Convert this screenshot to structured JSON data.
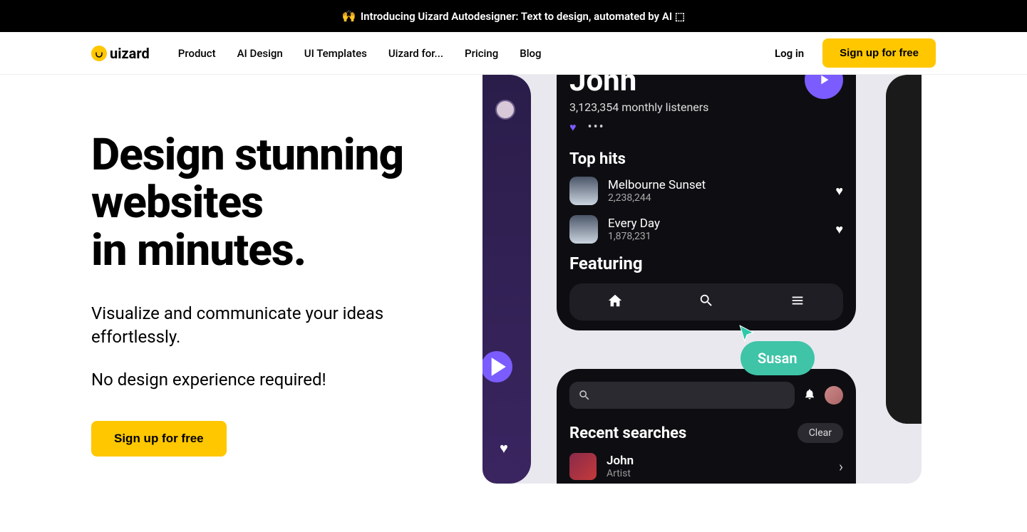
{
  "announcement": {
    "emoji": "🙌",
    "text": "Introducing Uizard Autodesigner: Text to design, automated by AI ⬚"
  },
  "brand": "uizard",
  "nav": {
    "items": [
      "Product",
      "AI Design",
      "UI Templates",
      "Uizard for...",
      "Pricing",
      "Blog"
    ],
    "login": "Log in",
    "signup": "Sign up for free"
  },
  "hero": {
    "h1_line1": "Design stunning",
    "h1_line2": "websites",
    "h1_line3": "in minutes.",
    "sub1": "Visualize and communicate your ideas effortlessly.",
    "sub2": "No design experience required!",
    "cta": "Sign up for free"
  },
  "mockup": {
    "artist": "John",
    "listeners": "3,123,354 monthly listeners",
    "top_hits_title": "Top hits",
    "tracks": [
      {
        "title": "Melbourne Sunset",
        "plays": "2,238,244"
      },
      {
        "title": "Every Day",
        "plays": "1,878,231"
      }
    ],
    "featuring": "Featuring",
    "collaborator": "Susan",
    "search_title": "Recent searches",
    "clear": "Clear",
    "recent": {
      "name": "John",
      "type": "Artist"
    }
  }
}
